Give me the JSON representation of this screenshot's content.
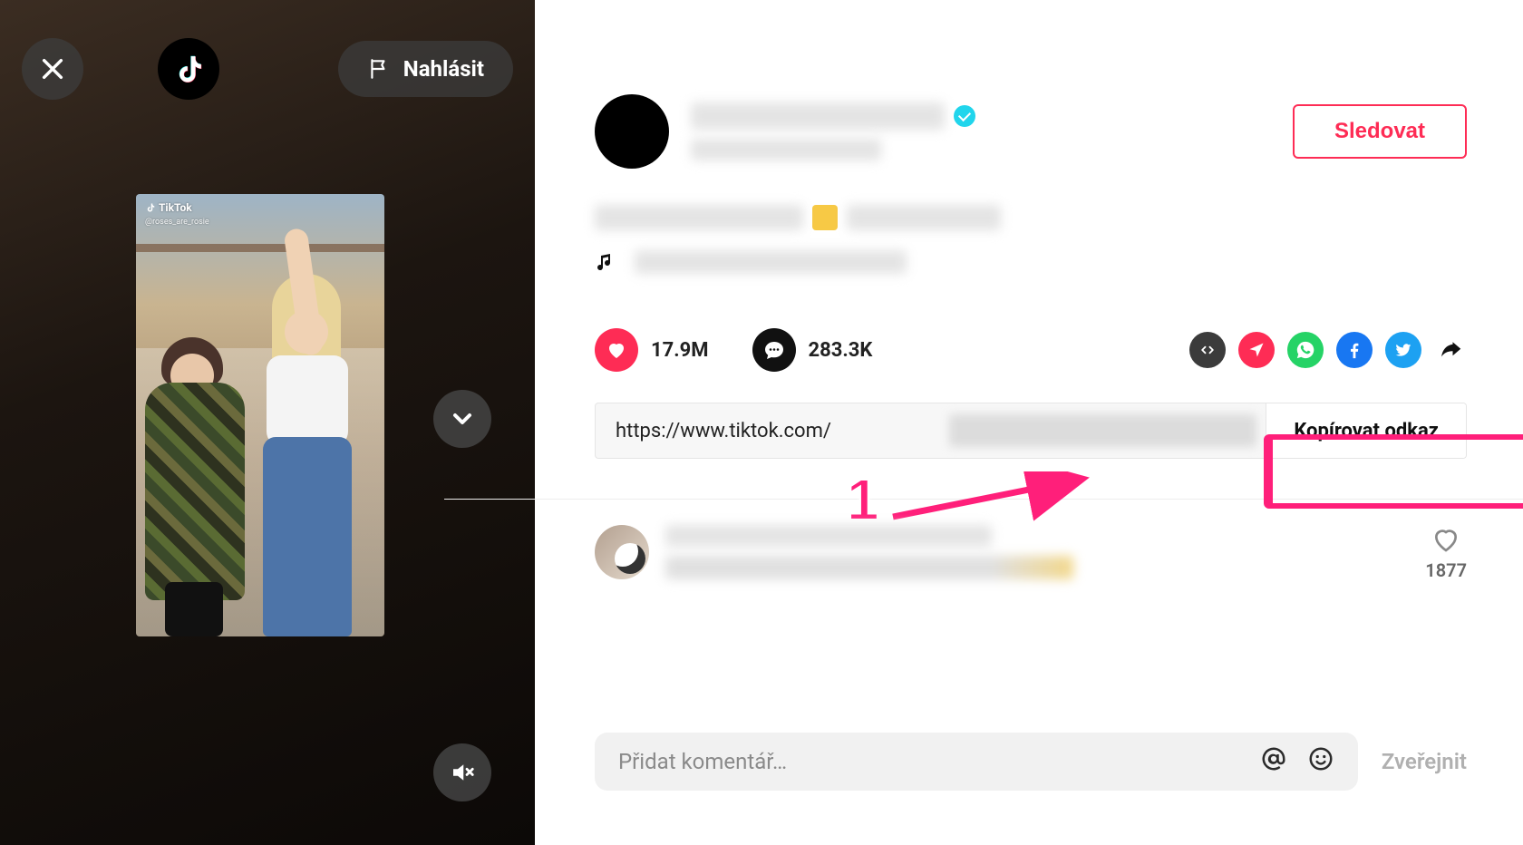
{
  "left": {
    "report_label": "Nahlásit",
    "watermark_brand": "TikTok",
    "watermark_handle": "@roses_are_rosie"
  },
  "profile": {
    "follow_label": "Sledovat"
  },
  "stats": {
    "likes": "17.9M",
    "comments": "283.3K"
  },
  "link": {
    "url_visible": "https://www.tiktok.com/",
    "copy_label": "Kopírovat odkaz"
  },
  "comment_preview": {
    "like_count": "1877"
  },
  "compose": {
    "placeholder": "Přidat komentář…",
    "post_label": "Zveřejnit"
  },
  "annotation": {
    "step": "1"
  }
}
